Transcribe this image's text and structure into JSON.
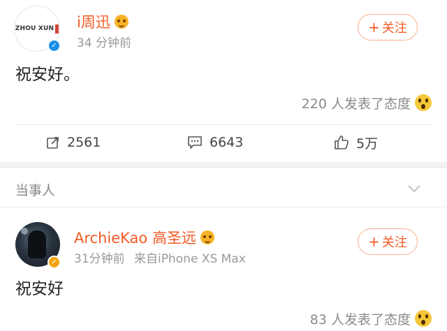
{
  "post1": {
    "avatar_text": "ZHOU XUN",
    "username": "i周迅",
    "time": "34 分钟前",
    "follow_label": "关注",
    "content": "祝安好。",
    "reactions": "220 人发表了态度"
  },
  "actions": {
    "repost_count": "2561",
    "comment_count": "6643",
    "like_count": "5万"
  },
  "section": {
    "label": "当事人"
  },
  "post2": {
    "username": "ArchieKao 高圣远",
    "time": "31分钟前",
    "source": "来自iPhone XS Max",
    "follow_label": "关注",
    "content": "祝安好",
    "reactions": "83 人发表了态度"
  },
  "colors": {
    "accent": "#f15a24",
    "verified_blue": "#1c8fe9",
    "verified_gold": "#f3a50e",
    "muted": "#999999"
  },
  "icons": {
    "repost": "repost-icon",
    "comment": "comment-icon",
    "like": "thumbs-up-icon",
    "expand": "chevron-down-icon"
  }
}
